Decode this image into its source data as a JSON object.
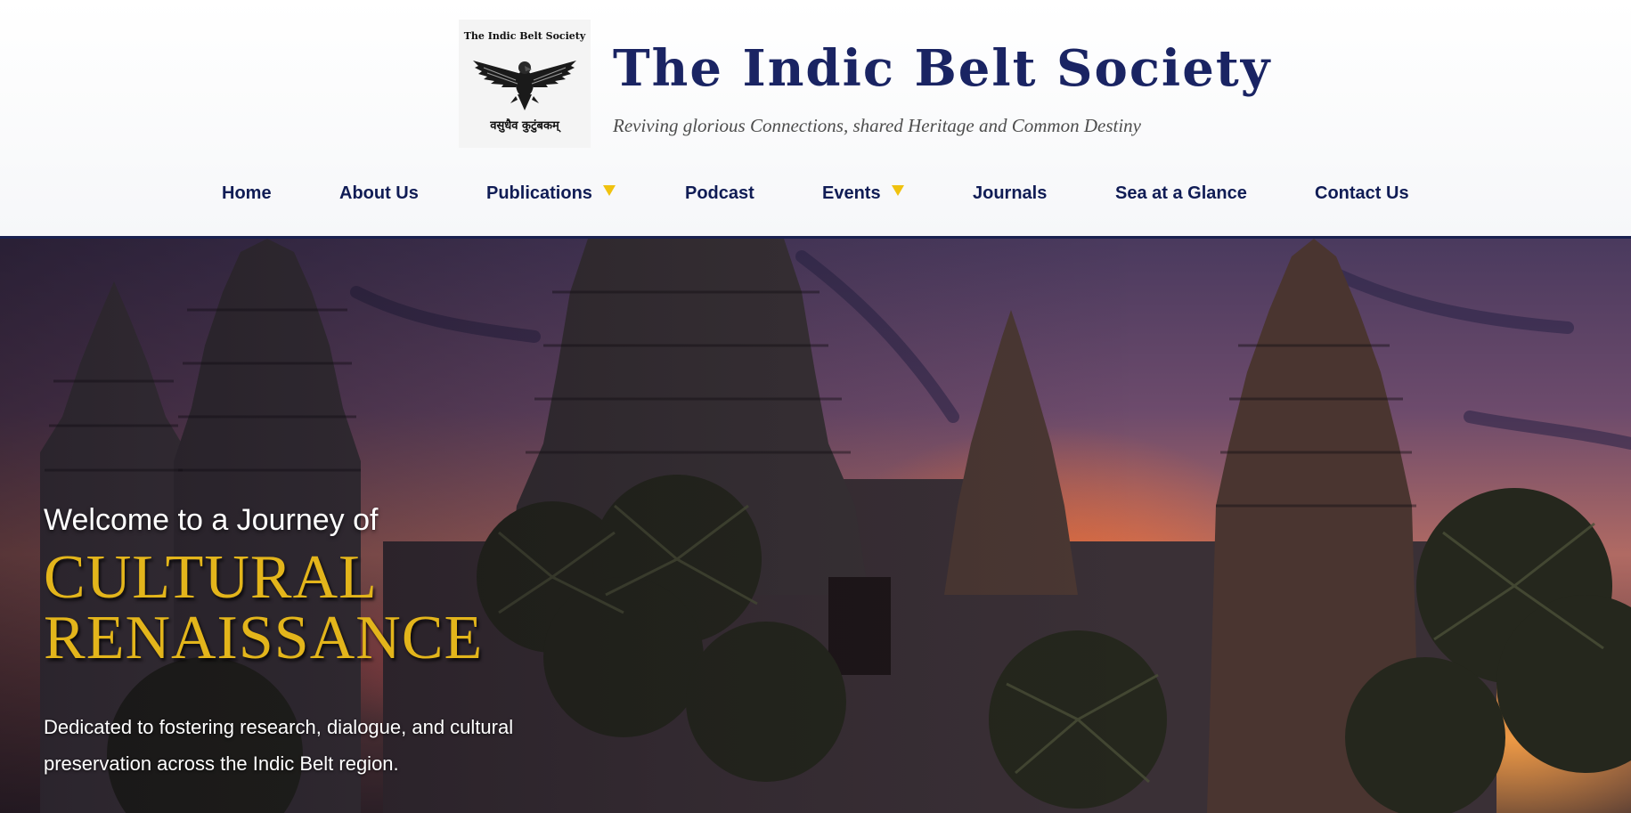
{
  "header": {
    "logo": {
      "text": "The Indic Belt Society",
      "motto": "वसुधैव कुटुंबकम्",
      "icon": "eagle-icon"
    },
    "title": "The Indic Belt Society",
    "tagline": "Reviving glorious Connections, shared Heritage and Common Destiny"
  },
  "nav": {
    "items": [
      {
        "label": "Home"
      },
      {
        "label": "About Us"
      },
      {
        "label": "Publications",
        "dropdown": true
      },
      {
        "label": "Podcast"
      },
      {
        "label": "Events",
        "dropdown": true
      },
      {
        "label": "Journals"
      },
      {
        "label": "Sea at a Glance"
      },
      {
        "label": "Contact Us"
      }
    ]
  },
  "hero": {
    "welcome": "Welcome to a Journey of",
    "title": "Cultural Renaissance",
    "description": "Dedicated to fostering research, dialogue, and cultural preservation across the Indic Belt region."
  },
  "colors": {
    "primary_navy": "#1a2463",
    "nav_text": "#101c55",
    "accent_gold": "#e3b51b",
    "dropdown_caret": "#f0c20f"
  }
}
